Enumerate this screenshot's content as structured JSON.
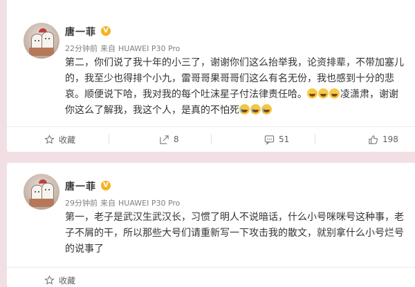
{
  "posts": [
    {
      "username": "唐一菲",
      "verified_badge": "V",
      "time": "22分钟前",
      "source_prefix": "来自",
      "source": "HUAWEI P30 Pro",
      "lines": [
        "第二，你们说了我十年的小三了，谢谢你们这么抬举我，论资排辈，不带加塞儿",
        "的，我至少也得排个小九，雷哥哥果哥哥们这么有名无份，我也感到十分的悲",
        "哀。顺便说下哈，我对我的每个吐沫星子付法律责任哈。",
        "凌潇肃，谢谢",
        "你这么了解我，我这个人，是真的不怕死"
      ],
      "actions": {
        "favorite": "收藏",
        "share": "8",
        "comment": "51",
        "like": "198"
      }
    },
    {
      "username": "唐一菲",
      "verified_badge": "V",
      "time": "29分钟前",
      "source_prefix": "来自",
      "source": "HUAWEI P30 Pro",
      "lines": [
        "第一，老子是武汉生武汉长，习惯了明人不说暗话，什么小号咪咪号这种事，老",
        "子不屑的干，所以那些大号们请重新写一下攻击我的散文，就别拿什么小号烂号",
        "的说事了"
      ],
      "actions": {
        "favorite": "收藏"
      }
    }
  ],
  "icons": {
    "verified": "verified-badge-icon",
    "favorite": "star-outline-icon",
    "share": "share-icon",
    "comment": "comment-icon",
    "like": "thumbs-up-icon",
    "emoji_laugh": "laughing-emoji-icon",
    "emoji_cry": "tears-of-joy-emoji-icon"
  },
  "colors": {
    "verified": "#f5b324",
    "background": "#f2dfe3"
  }
}
